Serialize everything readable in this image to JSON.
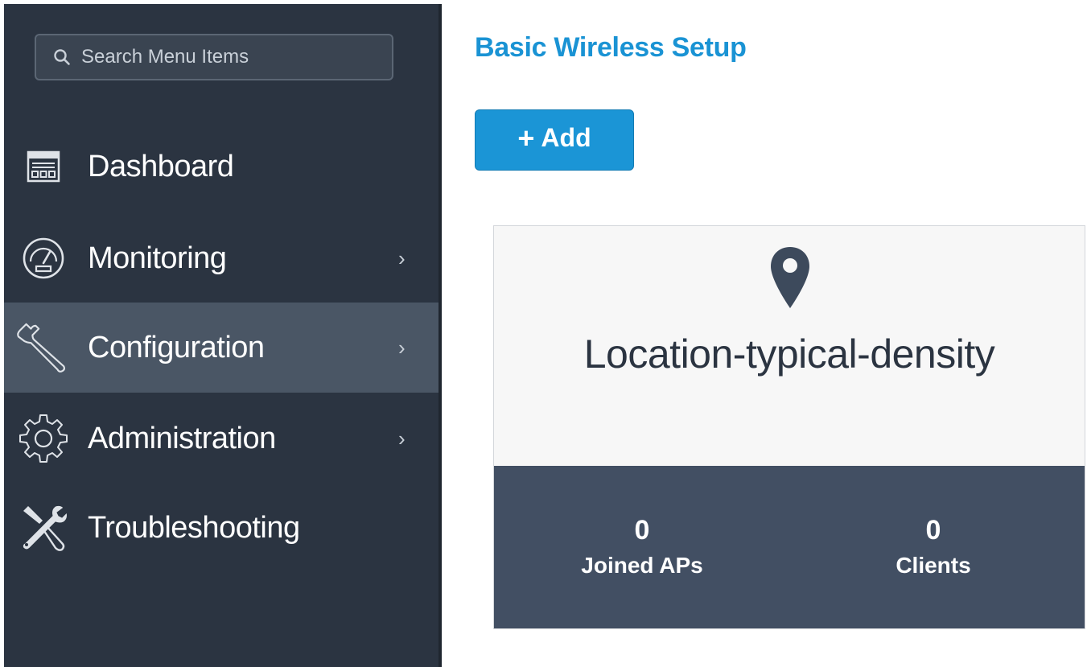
{
  "sidebar": {
    "search": {
      "placeholder": "Search Menu Items",
      "icon": "search-icon"
    },
    "items": [
      {
        "label": "Dashboard",
        "icon": "dashboard-icon",
        "has_submenu": false,
        "active": false
      },
      {
        "label": "Monitoring",
        "icon": "gauge-icon",
        "has_submenu": true,
        "active": false
      },
      {
        "label": "Configuration",
        "icon": "wrench-icon",
        "has_submenu": true,
        "active": true
      },
      {
        "label": "Administration",
        "icon": "gear-icon",
        "has_submenu": true,
        "active": false
      },
      {
        "label": "Troubleshooting",
        "icon": "tools-icon",
        "has_submenu": false,
        "active": false
      }
    ],
    "chevron": "›"
  },
  "main": {
    "title": "Basic Wireless Setup",
    "add_button": {
      "icon": "+",
      "label": "Add"
    },
    "card": {
      "icon": "location-pin-icon",
      "title": "Location-typical-density",
      "stats": [
        {
          "value": "0",
          "label": "Joined APs"
        },
        {
          "value": "0",
          "label": "Clients"
        }
      ]
    }
  },
  "colors": {
    "sidebar_bg": "#2b3441",
    "sidebar_active": "#4a5665",
    "accent_blue": "#1b95d6",
    "title_blue": "#1a93d4",
    "card_footer": "#424f63"
  }
}
